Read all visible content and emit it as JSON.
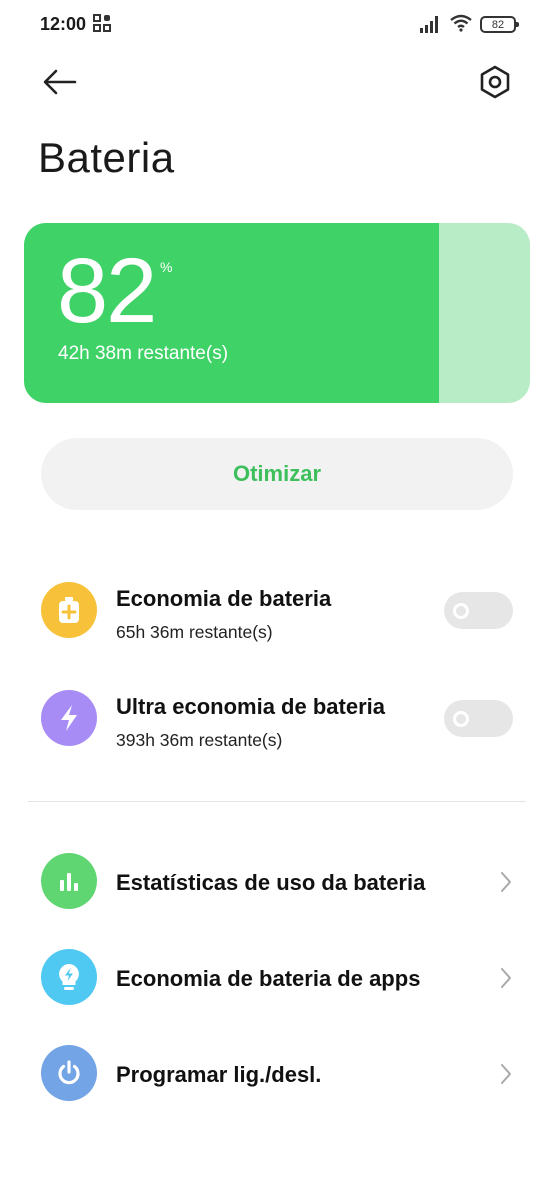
{
  "status_bar": {
    "time": "12:00",
    "battery_text": "82",
    "icons": [
      "qr-icon",
      "signal-icon",
      "wifi-icon",
      "battery-icon"
    ]
  },
  "header": {
    "title": "Bateria",
    "back_icon": "arrow-left-icon",
    "settings_icon": "hexagon-gear-icon"
  },
  "battery_card": {
    "level": "82",
    "unit": "%",
    "level_fraction": 0.82,
    "remaining": "42h 38m restante(s)",
    "fill_color": "#3fd267",
    "track_color": "#b8ecc6"
  },
  "optimize_button": {
    "label": "Otimizar",
    "color": "#3dbf5c"
  },
  "saver_options": [
    {
      "title": "Economia de bateria",
      "subtitle": "65h 36m restante(s)",
      "icon": "battery-plus-icon",
      "icon_color": "#f7c23a",
      "enabled": false
    },
    {
      "title": "Ultra economia de bateria",
      "subtitle": "393h 36m restante(s)",
      "icon": "lightning-icon",
      "icon_color": "#a88cf5",
      "enabled": false
    }
  ],
  "links": [
    {
      "title": "Estatísticas de uso da bateria",
      "icon": "bar-chart-icon",
      "icon_color": "#5fd672"
    },
    {
      "title": "Economia de bateria de apps",
      "icon": "bulb-bolt-icon",
      "icon_color": "#4fc8f2"
    },
    {
      "title": "Programar lig./desl.",
      "icon": "power-icon",
      "icon_color": "#72a4e6"
    }
  ]
}
